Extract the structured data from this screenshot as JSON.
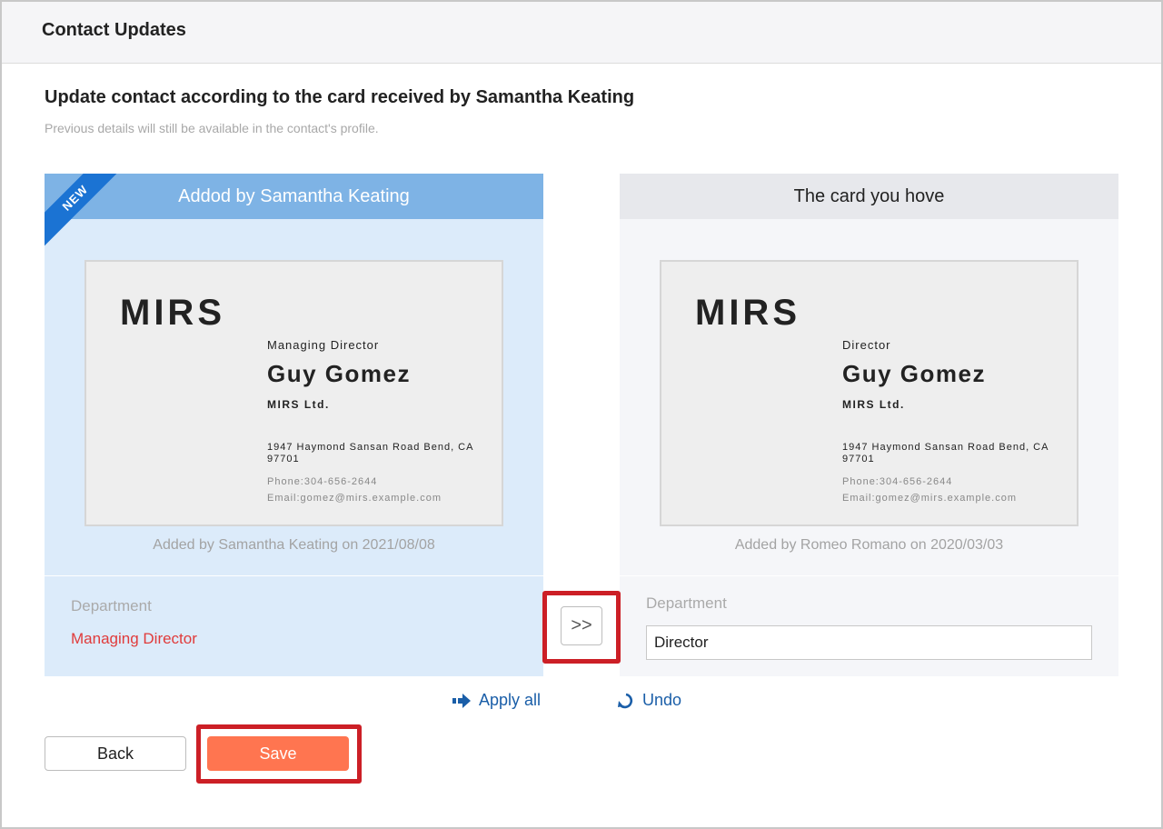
{
  "header": {
    "title": "Contact Updates"
  },
  "page": {
    "heading": "Update contact according to the card received by Samantha Keating",
    "subheading": "Previous details will still be available in the contact's profile."
  },
  "left_panel": {
    "ribbon": "NEW",
    "title": "Addod by Samantha Keating",
    "card": {
      "logo": "MIRS",
      "job_title": "Managing Director",
      "name": "Guy Gomez",
      "company": "MIRS Ltd.",
      "address": "1947 Haymond Sansan Road Bend, CA 97701",
      "phone": "Phone:304-656-2644",
      "email": "Email:gomez@mirs.example.com"
    },
    "added_by": "Added by Samantha Keating on 2021/08/08",
    "department_label": "Department",
    "department_value": "Managing Director"
  },
  "right_panel": {
    "title": "The card you hove",
    "card": {
      "logo": "MIRS",
      "job_title": "Director",
      "name": "Guy Gomez",
      "company": "MIRS Ltd.",
      "address": "1947 Haymond Sansan Road Bend, CA 97701",
      "phone": "Phone:304-656-2644",
      "email": "Email:gomez@mirs.example.com"
    },
    "added_by": "Added by Romeo Romano on 2020/03/03",
    "department_label": "Department",
    "department_value": "Director"
  },
  "copy_button": {
    "glyph": ">>"
  },
  "actions": {
    "apply_all": "Apply all",
    "undo": "Undo",
    "back": "Back",
    "save": "Save"
  },
  "colors": {
    "accent_blue": "#7eb3e5",
    "ribbon_blue": "#1b73d3",
    "link_blue": "#1a5ea8",
    "save_orange": "#ff7550",
    "highlight_red": "#cc1f26",
    "changed_red": "#e03b3b"
  },
  "icons": {
    "apply_all": "arrow-right-icon",
    "undo": "undo-icon",
    "copy": "double-chevron-right-icon"
  }
}
